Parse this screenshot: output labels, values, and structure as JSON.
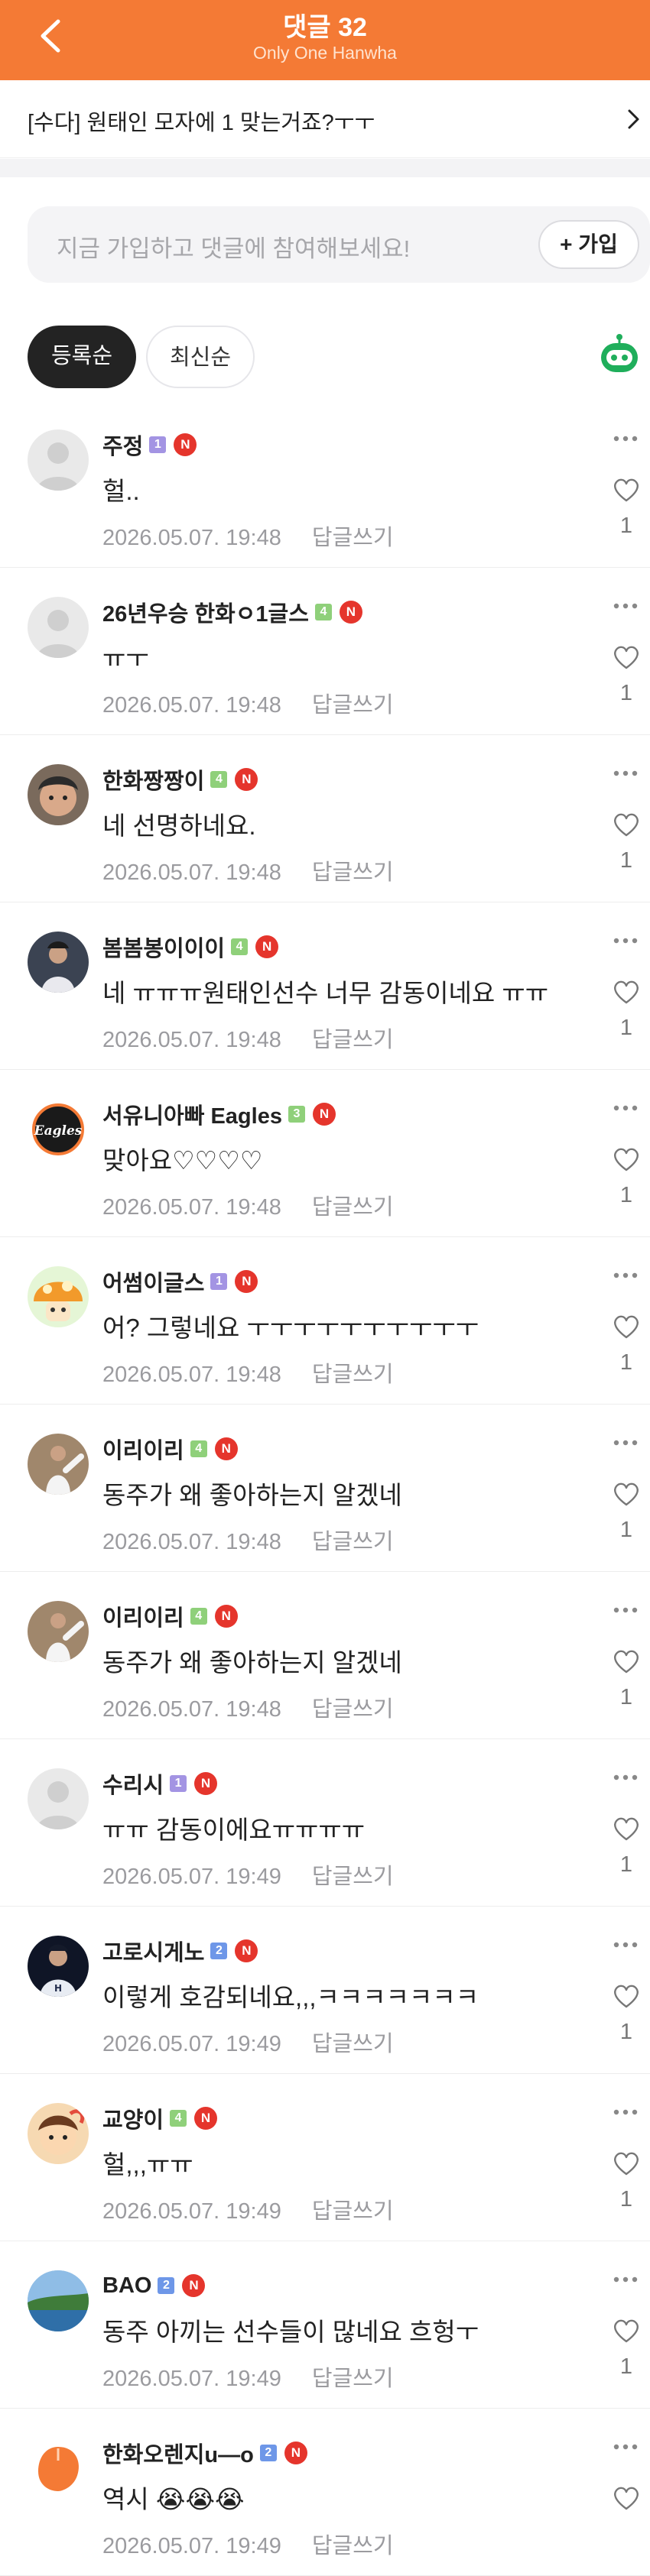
{
  "header": {
    "title": "댓글 32",
    "subtitle": "Only One Hanwha"
  },
  "post": {
    "title": "[수다] 원태인 모자에 1 맞는거죠?ㅜㅜ"
  },
  "join": {
    "placeholder": "지금 가입하고 댓글에 참여해보세요!",
    "button": "+ 가입"
  },
  "sort": {
    "registered": "등록순",
    "newest": "최신순"
  },
  "reply_label": "답글쓰기",
  "colors": {
    "brand": "#f47a35",
    "badge_red": "#e5352c",
    "robot_green": "#1fae5b"
  },
  "comments": [
    {
      "nick": "주정",
      "level": "1",
      "body": "헐..",
      "date": "2026.05.07. 19:48",
      "likes": "1",
      "avatar": "default"
    },
    {
      "nick": "26년우승 한화ㅇ1글스",
      "level": "4",
      "body": "ㅠㅜ",
      "date": "2026.05.07. 19:48",
      "likes": "1",
      "avatar": "default"
    },
    {
      "nick": "한화짱짱이",
      "level": "4",
      "body": "네 선명하네요.",
      "date": "2026.05.07. 19:48",
      "likes": "1",
      "avatar": "photo-child"
    },
    {
      "nick": "봄봄봉이이이",
      "level": "4",
      "body": "네 ㅠㅠㅠ원태인선수 너무 감동이네요 ㅠㅠ",
      "date": "2026.05.07. 19:48",
      "likes": "1",
      "avatar": "photo-player"
    },
    {
      "nick": "서유니아빠 Eagles",
      "level": "3",
      "body": "맞아요♡♡♡♡",
      "date": "2026.05.07. 19:48",
      "likes": "1",
      "avatar": "eagles-logo"
    },
    {
      "nick": "어썸이글스",
      "level": "1",
      "body": "어? 그렇네요 ㅜㅜㅜㅜㅜㅜㅜㅜㅜㅜ",
      "date": "2026.05.07. 19:48",
      "likes": "1",
      "avatar": "mushroom"
    },
    {
      "nick": "이리이리",
      "level": "4",
      "body": "동주가 왜 좋아하는지 알겠네",
      "date": "2026.05.07. 19:48",
      "likes": "1",
      "avatar": "photo-pitcher"
    },
    {
      "nick": "이리이리",
      "level": "4",
      "body": "동주가 왜 좋아하는지 알겠네",
      "date": "2026.05.07. 19:48",
      "likes": "1",
      "avatar": "photo-pitcher"
    },
    {
      "nick": "수리시",
      "level": "1",
      "body": "ㅠㅠ 감동이에요ㅠㅠㅠㅠ",
      "date": "2026.05.07. 19:49",
      "likes": "1",
      "avatar": "default"
    },
    {
      "nick": "고로시게노",
      "level": "2",
      "body": "이렇게 호감되네요,,,ㅋㅋㅋㅋㅋㅋㅋ",
      "date": "2026.05.07. 19:49",
      "likes": "1",
      "avatar": "photo-uniform"
    },
    {
      "nick": "교양이",
      "level": "4",
      "body": "헐,,,ㅠㅠ",
      "date": "2026.05.07. 19:49",
      "likes": "1",
      "avatar": "cartoon-boy"
    },
    {
      "nick": "BAO",
      "level": "2",
      "body": "동주 아끼는 선수들이 많네요 흐헝ㅜ",
      "date": "2026.05.07. 19:49",
      "likes": "1",
      "avatar": "photo-sea"
    },
    {
      "nick": "한화오렌지u—o",
      "level": "2",
      "body": "역시 😭😭😭",
      "date": "2026.05.07. 19:49",
      "likes": "",
      "avatar": "orange-blob"
    }
  ]
}
